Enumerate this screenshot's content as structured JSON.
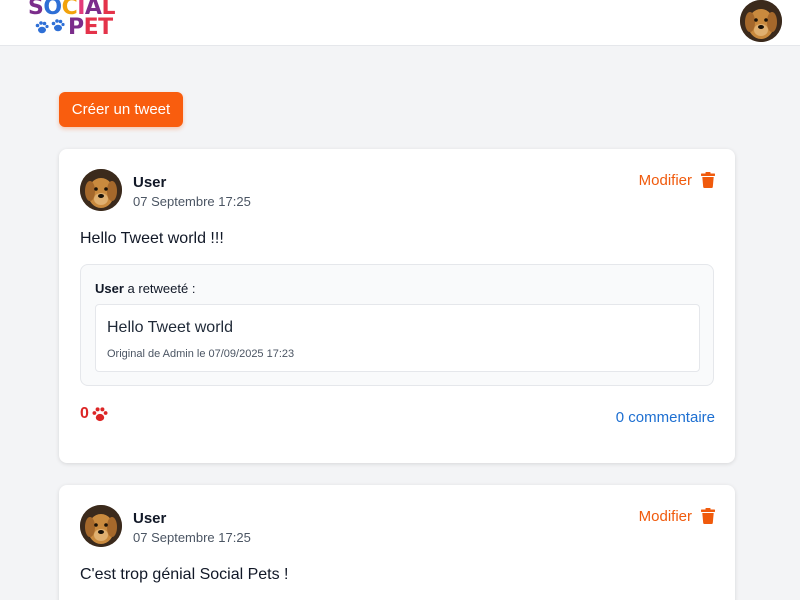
{
  "app": {
    "logo_line1": "SOCIAL",
    "logo_line2": "PET"
  },
  "colors": {
    "accent": "#f95d0e",
    "like": "#dc2626",
    "link": "#1d6fd1"
  },
  "actions": {
    "create_label": "Créer un tweet"
  },
  "tweets": [
    {
      "username": "User",
      "date": "07 Septembre 17:25",
      "edit_label": "Modifier",
      "content": "Hello Tweet world !!!",
      "retweet": {
        "user": "User",
        "label_suffix": " a retweeté :",
        "content": "Hello Tweet world",
        "meta": "Original de Admin le 07/09/2025 17:23"
      },
      "likes": "0",
      "comments_label": "0 commentaire"
    },
    {
      "username": "User",
      "date": "07 Septembre 17:25",
      "edit_label": "Modifier",
      "content": "C'est trop génial Social Pets !"
    }
  ],
  "icons": [
    "paw-icon",
    "trash-icon",
    "avatar"
  ]
}
